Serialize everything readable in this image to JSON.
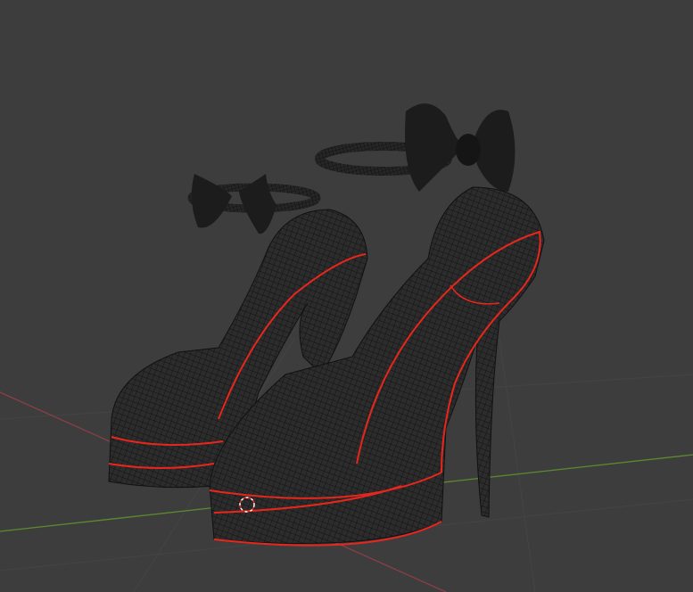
{
  "viewport": {
    "mode": "wireframe",
    "colors": {
      "background": "#3d3d3d",
      "grid": "#454545",
      "x_axis": "#8a3f47",
      "y_axis": "#5e8a2e",
      "mesh_fill": "#2a2a2a",
      "wire": "#101010",
      "selected_edge": "#e8261c",
      "bow": "#1c1c1c"
    }
  }
}
